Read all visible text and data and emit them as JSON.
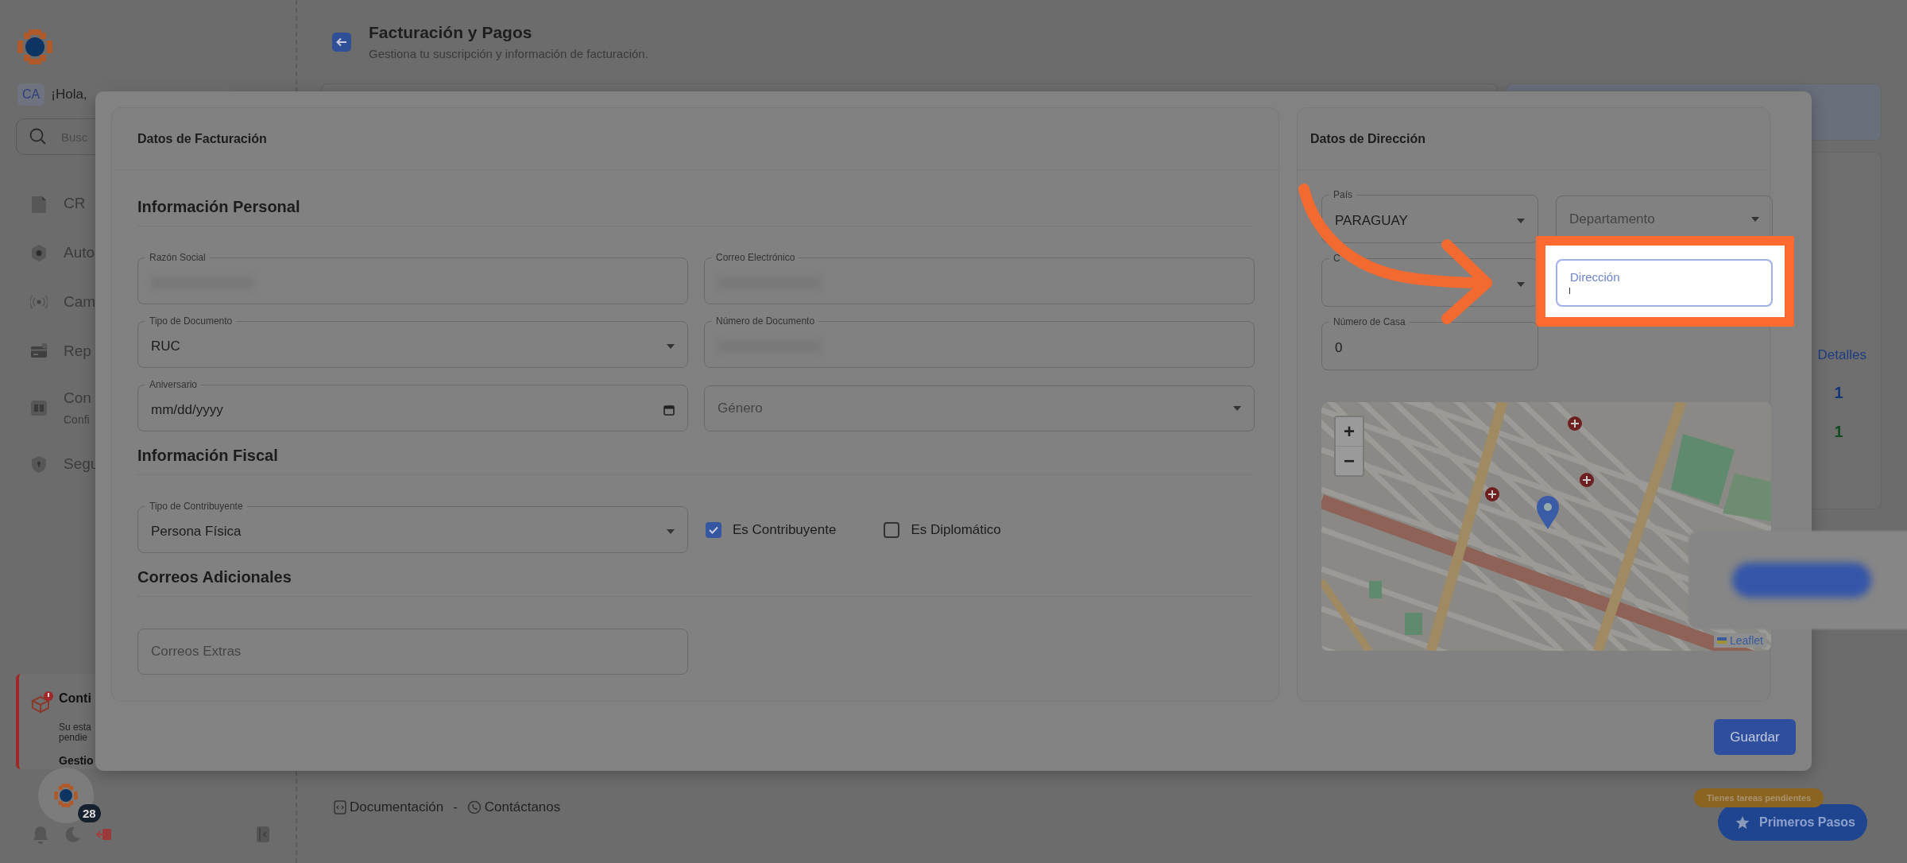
{
  "sidebar": {
    "initials": "CA",
    "greeting": "¡Hola,",
    "search": {
      "placeholder": "Busc"
    },
    "items": [
      {
        "kind": "document",
        "label": "CR"
      },
      {
        "kind": "hexagon",
        "label": "Auto"
      },
      {
        "kind": "broadcast",
        "label": "Cam"
      },
      {
        "kind": "card",
        "label": "Rep"
      },
      {
        "kind": "book",
        "label": "Con",
        "sublabel": "Confi"
      },
      {
        "kind": "shield",
        "label": "Segu"
      }
    ],
    "alert": {
      "title": "Conti",
      "text_lines": [
        "Su esta",
        "pendie"
      ],
      "link": "Gestio"
    },
    "assistant_badge": "28"
  },
  "header": {
    "title": "Facturación y Pagos",
    "subtitle": "Gestiona tu suscripción y información de facturación."
  },
  "background_panel": {
    "column_label": "Detalles",
    "values": [
      "1",
      "1"
    ]
  },
  "footer": {
    "links": [
      "Documentación",
      "Contáctanos"
    ],
    "separator": "-"
  },
  "modal": {
    "billing": {
      "title": "Datos de Facturación",
      "sections": [
        {
          "title": "Información Personal",
          "fields": [
            {
              "kind": "blurred",
              "label": "Razón Social"
            },
            {
              "kind": "blurred",
              "label": "Correo Electrónico"
            },
            {
              "kind": "select",
              "label": "Tipo de Documento",
              "value": "RUC"
            },
            {
              "kind": "blurred",
              "label": "Número de Documento"
            },
            {
              "kind": "date",
              "label": "Aniversario",
              "value": "mm/dd/yyyy"
            },
            {
              "kind": "select",
              "placeholder": "Género"
            }
          ]
        },
        {
          "title": "Información Fiscal",
          "fields": [
            {
              "kind": "select",
              "label": "Tipo de Contribuyente",
              "value": "Persona Física"
            },
            {
              "kind": "checkbox",
              "label": "Es Contribuyente",
              "checked": true
            },
            {
              "kind": "checkbox",
              "label": "Es Diplomático",
              "checked": false
            }
          ]
        },
        {
          "title": "Correos Adicionales",
          "fields": [
            {
              "kind": "text",
              "placeholder": "Correos Extras"
            }
          ]
        }
      ]
    },
    "address": {
      "title": "Datos de Dirección",
      "fields": [
        {
          "kind": "select",
          "label": "País",
          "value": "PARAGUAY"
        },
        {
          "kind": "select",
          "placeholder": "Departamento"
        },
        {
          "kind": "select",
          "label": "C"
        },
        {
          "kind": "text",
          "placeholder": "Dirección",
          "highlighted": true
        },
        {
          "kind": "text",
          "label": "Número de Casa",
          "value": "0"
        }
      ],
      "map": {
        "zoom_in": "+",
        "zoom_out": "−",
        "attribution": "Leaflet"
      }
    },
    "save_button": "Guardar"
  },
  "tour": {
    "badge": "Tienes tareas pendientes",
    "button": "Primeros Pasos"
  }
}
